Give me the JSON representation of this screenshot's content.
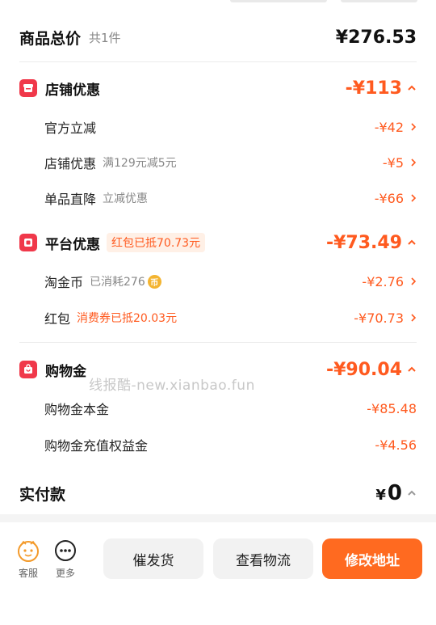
{
  "summary": {
    "title": "商品总价",
    "count": "共1件",
    "amount": "¥276.53"
  },
  "sections": [
    {
      "title": "店铺优惠",
      "badge": "",
      "amount": "-¥113",
      "items": [
        {
          "label": "官方立减",
          "note": "",
          "amount": "-¥42"
        },
        {
          "label": "店铺优惠",
          "note": "满129元减5元",
          "amount": "-¥5"
        },
        {
          "label": "单品直降",
          "note": "立减优惠",
          "amount": "-¥66"
        }
      ]
    },
    {
      "title": "平台优惠",
      "badge": "红包已抵70.73元",
      "amount": "-¥73.49",
      "items": [
        {
          "label": "淘金币",
          "note": "已消耗276",
          "coin": "币",
          "amount": "-¥2.76"
        },
        {
          "label": "红包",
          "note": "消费券已抵20.03元",
          "amount": "-¥70.73"
        }
      ]
    },
    {
      "title": "购物金",
      "badge": "",
      "amount": "-¥90.04",
      "items": [
        {
          "label": "购物金本金",
          "note": "",
          "amount": "-¥85.48"
        },
        {
          "label": "购物金充值权益金",
          "note": "",
          "amount": "-¥4.56"
        }
      ]
    }
  ],
  "watermark": "线报酷-new.xianbao.fun",
  "paid": {
    "title": "实付款",
    "currency": "¥",
    "amount": "0"
  },
  "bottom_bar": {
    "service_label": "客服",
    "more_label": "更多",
    "urge_button": "催发货",
    "logistics_button": "查看物流",
    "address_button": "修改地址"
  },
  "colors": {
    "accent": "#ff5a1f",
    "primary_button": "#ff6a20",
    "section_icon": "#f0384a"
  }
}
